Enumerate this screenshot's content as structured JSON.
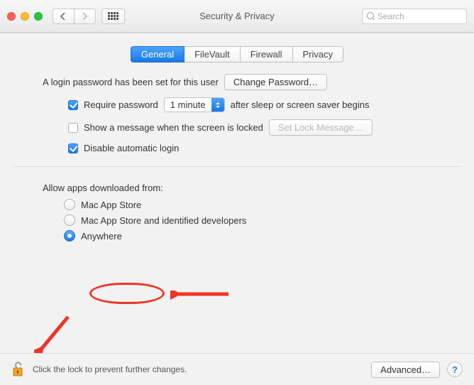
{
  "window": {
    "title": "Security & Privacy",
    "search_placeholder": "Search"
  },
  "tabs": {
    "general": "General",
    "filevault": "FileVault",
    "firewall": "Firewall",
    "privacy": "Privacy"
  },
  "login": {
    "password_set_text": "A login password has been set for this user",
    "change_password_button": "Change Password…",
    "require_password_label": "Require password",
    "require_password_delay": "1 minute",
    "require_password_suffix": "after sleep or screen saver begins",
    "show_message_label": "Show a message when the screen is locked",
    "set_lock_message_button": "Set Lock Message…",
    "disable_auto_login_label": "Disable automatic login"
  },
  "allow_apps": {
    "heading": "Allow apps downloaded from:",
    "opt_appstore": "Mac App Store",
    "opt_identified": "Mac App Store and identified developers",
    "opt_anywhere": "Anywhere"
  },
  "footer": {
    "lock_message": "Click the lock to prevent further changes.",
    "advanced_button": "Advanced…",
    "help_label": "?"
  },
  "annotations": {
    "arrow_color": "#ee3524"
  }
}
